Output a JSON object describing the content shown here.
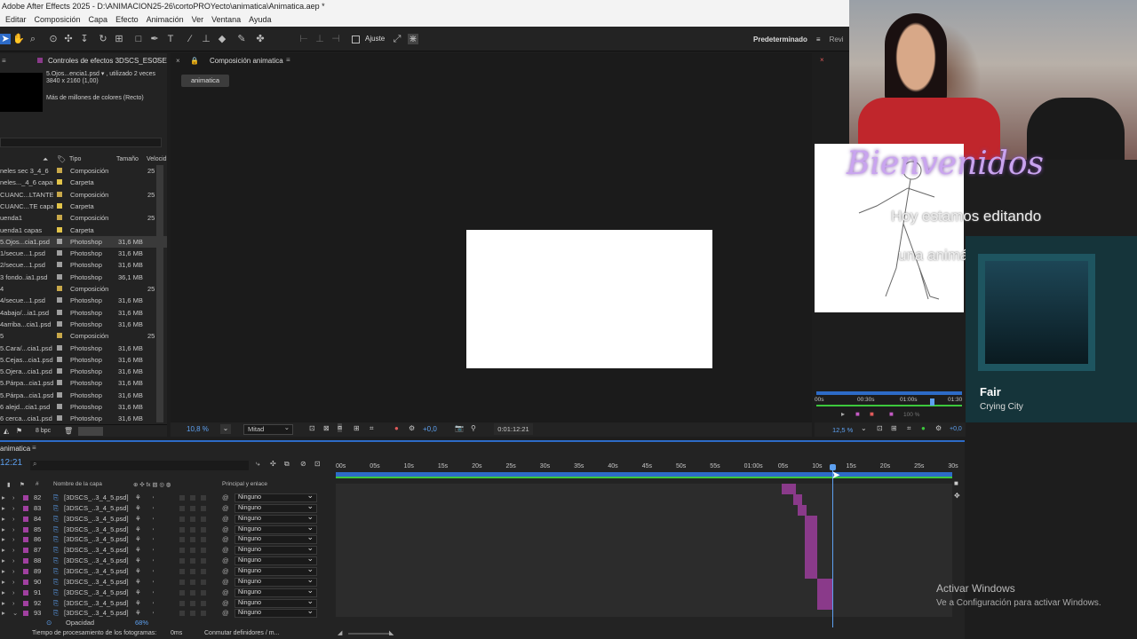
{
  "titlebar": {
    "title": "Adobe After Effects 2025 - D:\\ANIMACION25-26\\cortoPROYecto\\animatica\\Animatica.aep *"
  },
  "menu": [
    "Editar",
    "Composición",
    "Capa",
    "Efecto",
    "Animación",
    "Ver",
    "Ventana",
    "Ayuda"
  ],
  "toolbar": {
    "ajuste_label": "Ajuste",
    "workspace": "Predeterminado",
    "workspace2": "Revi"
  },
  "project": {
    "effects_tab": "Controles de efectos 3DSCS_ESCSE",
    "selected_name": "5.Ojos...encia1.psd ▾ , utilizado 2 veces",
    "selected_dims": "3840 x 2160 (1,00)",
    "selected_colors": "Más de millones de colores (Recto)",
    "col_type": "Tipo",
    "col_size": "Tamaño",
    "col_speed": "Velocid",
    "rows": [
      {
        "name": "neles sec 3_4_6",
        "type": "Composición",
        "size": "",
        "speed": "25",
        "color": "#c8a84a"
      },
      {
        "name": "neles..._4_6 capas",
        "type": "Carpeta",
        "size": "",
        "speed": "",
        "color": "#e2c44a"
      },
      {
        "name": "CUANC...LTANTE",
        "type": "Composición",
        "size": "",
        "speed": "25",
        "color": "#c8a84a"
      },
      {
        "name": "CUANC...TE capas",
        "type": "Carpeta",
        "size": "",
        "speed": "",
        "color": "#e2c44a"
      },
      {
        "name": "uenda1",
        "type": "Composición",
        "size": "",
        "speed": "25",
        "color": "#c8a84a"
      },
      {
        "name": "uenda1 capas",
        "type": "Carpeta",
        "size": "",
        "speed": "",
        "color": "#e2c44a"
      },
      {
        "name": "5.Ojos...cia1.psd",
        "type": "Photoshop",
        "size": "31,6 MB",
        "speed": "",
        "color": "#a0a0a0"
      },
      {
        "name": "1/secue...1.psd",
        "type": "Photoshop",
        "size": "31,6 MB",
        "speed": "",
        "color": "#a0a0a0"
      },
      {
        "name": "2/secue...1.psd",
        "type": "Photoshop",
        "size": "31,6 MB",
        "speed": "",
        "color": "#a0a0a0"
      },
      {
        "name": "3 fondo..ia1.psd",
        "type": "Photoshop",
        "size": "36,1 MB",
        "speed": "",
        "color": "#a0a0a0"
      },
      {
        "name": "4",
        "type": "Composición",
        "size": "",
        "speed": "25",
        "color": "#c8a84a"
      },
      {
        "name": "4/secue...1.psd",
        "type": "Photoshop",
        "size": "31,6 MB",
        "speed": "",
        "color": "#a0a0a0"
      },
      {
        "name": "4abajo/...ia1.psd",
        "type": "Photoshop",
        "size": "31,6 MB",
        "speed": "",
        "color": "#a0a0a0"
      },
      {
        "name": "4arriba...cia1.psd",
        "type": "Photoshop",
        "size": "31,6 MB",
        "speed": "",
        "color": "#a0a0a0"
      },
      {
        "name": "5",
        "type": "Composición",
        "size": "",
        "speed": "25",
        "color": "#c8a84a"
      },
      {
        "name": "5.Cara/...cia1.psd",
        "type": "Photoshop",
        "size": "31,6 MB",
        "speed": "",
        "color": "#a0a0a0"
      },
      {
        "name": "5.Cejas...cia1.psd",
        "type": "Photoshop",
        "size": "31,6 MB",
        "speed": "",
        "color": "#a0a0a0"
      },
      {
        "name": "5.Ojera...cia1.psd",
        "type": "Photoshop",
        "size": "31,6 MB",
        "speed": "",
        "color": "#a0a0a0"
      },
      {
        "name": "5.Párpa...cia1.psd",
        "type": "Photoshop",
        "size": "31,6 MB",
        "speed": "",
        "color": "#a0a0a0"
      },
      {
        "name": "5.Párpa...cia1.psd",
        "type": "Photoshop",
        "size": "31,6 MB",
        "speed": "",
        "color": "#a0a0a0"
      },
      {
        "name": "6 alejd...cia1.psd",
        "type": "Photoshop",
        "size": "31,6 MB",
        "speed": "",
        "color": "#a0a0a0"
      },
      {
        "name": "6 cerca...cia1.psd",
        "type": "Photoshop",
        "size": "31,6 MB",
        "speed": "",
        "color": "#a0a0a0"
      }
    ],
    "bpc": "8 bpc"
  },
  "comp": {
    "tab_label": "Composición animatica",
    "chip": "animatica",
    "zoom": "10,8 %",
    "resolution": "Mitad",
    "exposure": "+0,0",
    "timecode": "0:01:12:21"
  },
  "right_preview": {
    "zoom": "12,5 %",
    "exposure": "+0,0",
    "ticks": [
      "00s",
      "00:30s",
      "01:00s",
      "01:30"
    ],
    "label100": "100 %"
  },
  "timeline": {
    "tab": "animatica",
    "time": "12:21",
    "col_layer": "Nombre de la capa",
    "col_parent": "Principal y enlace",
    "ruler": [
      "00s",
      "05s",
      "10s",
      "15s",
      "20s",
      "25s",
      "30s",
      "35s",
      "40s",
      "45s",
      "50s",
      "55s",
      "01:00s",
      "05s",
      "10s",
      "15s",
      "20s",
      "25s",
      "30s"
    ],
    "layers": [
      {
        "num": "82",
        "name": "[3DSCS_..3_4_5.psd]",
        "parent": "Ninguno"
      },
      {
        "num": "83",
        "name": "[3DSCS_..3_4_5.psd]",
        "parent": "Ninguno"
      },
      {
        "num": "84",
        "name": "[3DSCS_..3_4_5.psd]",
        "parent": "Ninguno"
      },
      {
        "num": "85",
        "name": "[3DSCS_..3_4_5.psd]",
        "parent": "Ninguno"
      },
      {
        "num": "86",
        "name": "[3DSCS_..3_4_5.psd]",
        "parent": "Ninguno"
      },
      {
        "num": "87",
        "name": "[3DSCS_..3_4_5.psd]",
        "parent": "Ninguno"
      },
      {
        "num": "88",
        "name": "[3DSCS_..3_4_5.psd]",
        "parent": "Ninguno"
      },
      {
        "num": "89",
        "name": "[3DSCS_..3_4_5.psd]",
        "parent": "Ninguno"
      },
      {
        "num": "90",
        "name": "[3DSCS_..3_4_5.psd]",
        "parent": "Ninguno"
      },
      {
        "num": "91",
        "name": "[3DSCS_..3_4_5.psd]",
        "parent": "Ninguno"
      },
      {
        "num": "92",
        "name": "[3DSCS_..3_4_5.psd]",
        "parent": "Ninguno"
      },
      {
        "num": "93",
        "name": "[3DSCS_..3_4_5.psd]",
        "parent": "Ninguno"
      }
    ],
    "sub_prop": "Opacidad",
    "sub_value": "68%"
  },
  "status": {
    "render": "Tiempo de procesamiento de los fotogramas:",
    "render_value": "0ms",
    "toggle": "Conmutar definidores / m..."
  },
  "overlay": {
    "welcome": "Bienvenidos",
    "line1": "Hoy estamos editando",
    "line2": "una animática"
  },
  "music": {
    "title": "Fair",
    "artist": "Crying City"
  },
  "activation": {
    "title": "Activar Windows",
    "subtitle": "Ve a Configuración para activar Windows."
  }
}
